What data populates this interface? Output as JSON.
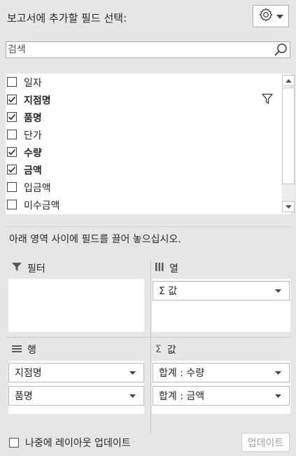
{
  "header": {
    "title": "보고서에 추가할 필드 선택:",
    "settings_icon": "gear-icon"
  },
  "search": {
    "placeholder": "검색"
  },
  "fields": [
    {
      "label": "일자",
      "checked": false,
      "bold": false
    },
    {
      "label": "지점명",
      "checked": true,
      "bold": true,
      "filtered": true
    },
    {
      "label": "품명",
      "checked": true,
      "bold": true
    },
    {
      "label": "단가",
      "checked": false,
      "bold": false
    },
    {
      "label": "수량",
      "checked": true,
      "bold": true
    },
    {
      "label": "금액",
      "checked": true,
      "bold": true
    },
    {
      "label": "입금액",
      "checked": false,
      "bold": false
    },
    {
      "label": "미수금액",
      "checked": false,
      "bold": false
    }
  ],
  "instruction": "아래 영역 사이에 필드를 끌어 놓으십시오.",
  "areas": {
    "filter": {
      "title": "필터",
      "items": []
    },
    "columns": {
      "title": "열",
      "items": [
        "Σ 값"
      ]
    },
    "rows": {
      "title": "행",
      "items": [
        "지점명",
        "품명"
      ]
    },
    "values": {
      "title": "값",
      "items": [
        "합계 : 수량",
        "합계 : 금액"
      ]
    }
  },
  "footer": {
    "defer_label": "나중에 레이아웃 업데이트",
    "defer_checked": false,
    "update_label": "업데이트"
  },
  "colors": {
    "panel_bg": "#e6e6e6",
    "border": "#ababab",
    "text": "#262626",
    "disabled_text": "#a0a0a0"
  }
}
